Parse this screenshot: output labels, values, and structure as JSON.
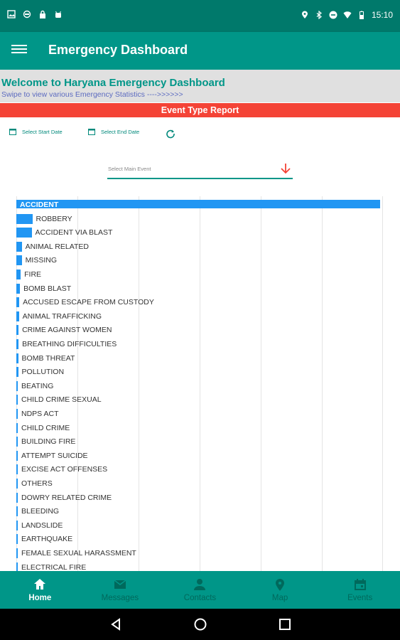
{
  "status_bar": {
    "time": "15:10",
    "left_icons": [
      "image-icon",
      "vpn-icon",
      "lock-icon",
      "android-icon"
    ],
    "right_icons": [
      "location-icon",
      "bluetooth-icon",
      "dnd-icon",
      "wifi-icon",
      "battery-icon"
    ]
  },
  "app_bar": {
    "title": "Emergency Dashboard",
    "menu_icon": "hamburger-menu-icon"
  },
  "welcome": {
    "heading": "Welcome to Haryana Emergency Dashboard",
    "subheading": "Swipe to view various Emergency Statistics ---->>>>>>"
  },
  "report": {
    "title": "Event Type Report"
  },
  "filters": {
    "start_date_label": "Select Start Date",
    "end_date_label": "Select End Date",
    "main_event_placeholder": "Select Main Event"
  },
  "colors": {
    "primary": "#009688",
    "primary_dark": "#00796b",
    "accent_red": "#f44336",
    "bar": "#2196f3"
  },
  "chart_data": {
    "type": "bar",
    "orientation": "horizontal",
    "grid": true,
    "categories": [
      "ACCIDENT",
      "ROBBERY",
      "ACCIDENT VIA BLAST",
      "ANIMAL RELATED",
      "MISSING",
      "FIRE",
      "BOMB BLAST",
      "ACCUSED ESCAPE FROM CUSTODY",
      "ANIMAL TRAFFICKING",
      "CRIME AGAINST WOMEN",
      "BREATHING DIFFICULTIES",
      "BOMB THREAT",
      "POLLUTION",
      "BEATING",
      "CHILD CRIME SEXUAL",
      "NDPS ACT",
      "CHILD CRIME",
      "BUILDING FIRE",
      "ATTEMPT SUICIDE",
      "EXCISE ACT OFFENSES",
      "OTHERS",
      "DOWRY RELATED CRIME",
      "BLEEDING",
      "LANDSLIDE",
      "EARTHQUAKE",
      "FEMALE SEXUAL HARASSMENT",
      "ELECTRICAL FIRE"
    ],
    "values": [
      100,
      4.4,
      4.2,
      1.5,
      1.5,
      1.2,
      1.0,
      0.8,
      0.7,
      0.6,
      0.6,
      0.5,
      0.5,
      0.4,
      0.3,
      0.3,
      0.3,
      0.3,
      0.3,
      0.3,
      0.3,
      0.3,
      0.3,
      0.3,
      0.3,
      0.3,
      0.3
    ],
    "xlim": [
      0,
      100
    ]
  },
  "bottom_nav": [
    {
      "label": "Home",
      "icon": "home-icon",
      "active": true
    },
    {
      "label": "Messages",
      "icon": "mail-icon",
      "active": false
    },
    {
      "label": "Contacts",
      "icon": "person-icon",
      "active": false
    },
    {
      "label": "Map",
      "icon": "map-pin-icon",
      "active": false
    },
    {
      "label": "Events",
      "icon": "calendar-icon",
      "active": false
    }
  ],
  "system_nav": [
    "back-icon",
    "home-circle-icon",
    "recents-icon"
  ]
}
